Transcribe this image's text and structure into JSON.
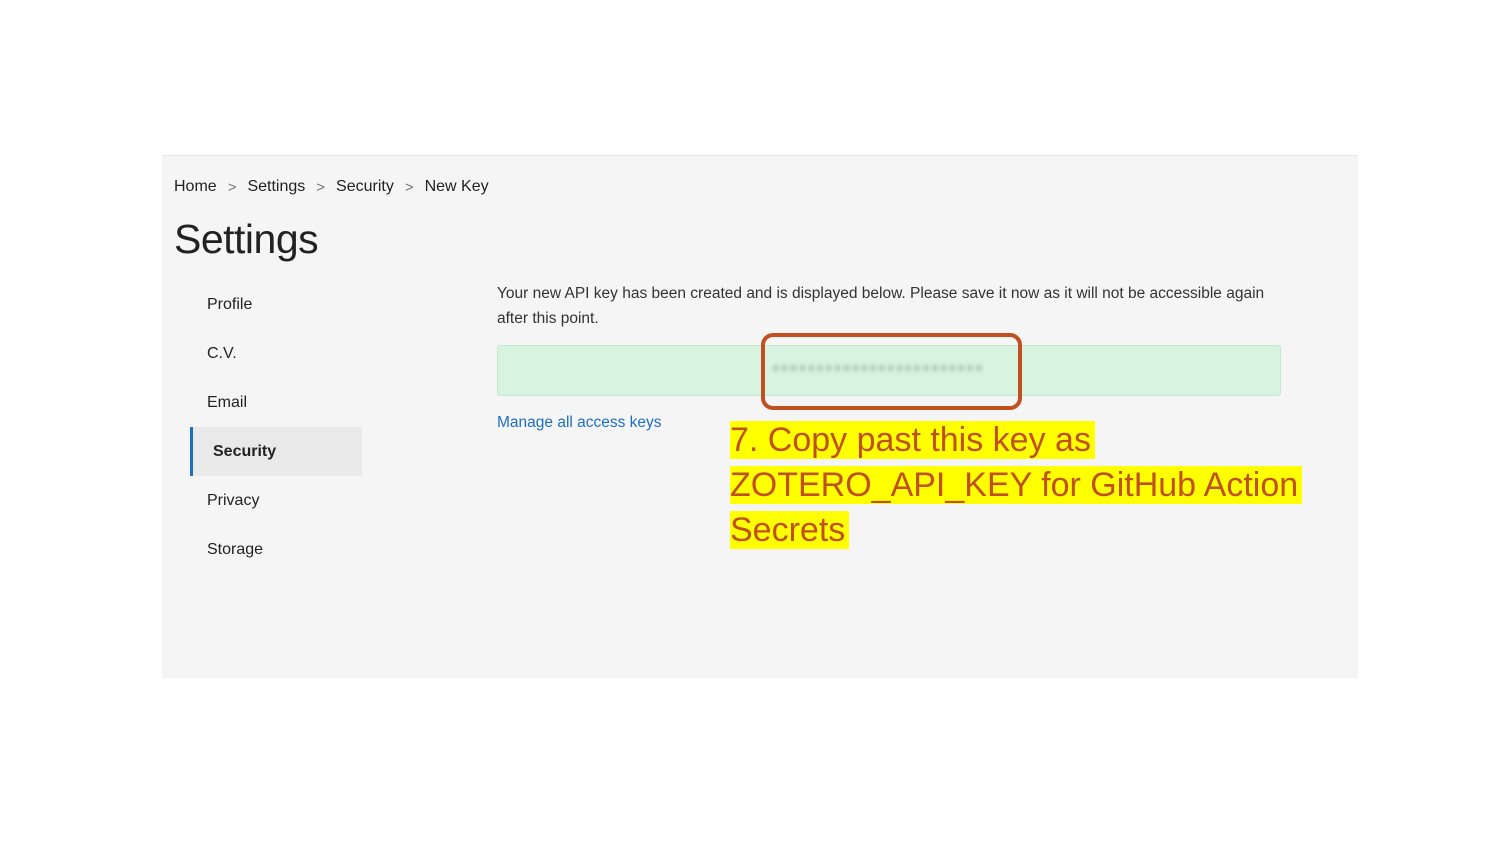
{
  "breadcrumb": {
    "items": [
      "Home",
      "Settings",
      "Security",
      "New Key"
    ],
    "separator": ">"
  },
  "page_title": "Settings",
  "sidebar": {
    "items": [
      {
        "label": "Profile",
        "active": false
      },
      {
        "label": "C.V.",
        "active": false
      },
      {
        "label": "Email",
        "active": false
      },
      {
        "label": "Security",
        "active": true
      },
      {
        "label": "Privacy",
        "active": false
      },
      {
        "label": "Storage",
        "active": false
      }
    ]
  },
  "main": {
    "message": "Your new API key has been created and is displayed below. Please save it now as it will not be accessible again after this point.",
    "api_key_obscured": "••••••••••••••••••••••••",
    "manage_link": "Manage all access keys"
  },
  "annotation": {
    "text": "7. Copy past this key as ZOTERO_API_KEY for GitHub Action Secrets"
  },
  "colors": {
    "panel_bg": "#f5f5f5",
    "active_indicator": "#1d6fc2",
    "key_box_bg": "#d8f3df",
    "highlight_border": "#c0501f",
    "annotation_bg": "#ffff00",
    "annotation_text": "#c0501f",
    "link": "#1d6fc2"
  }
}
